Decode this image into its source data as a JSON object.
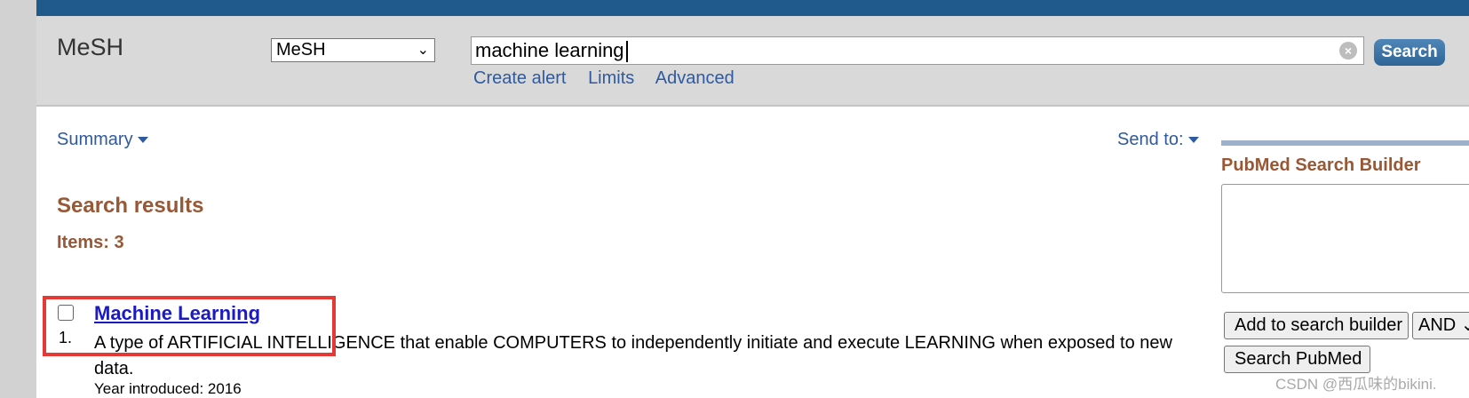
{
  "header": {
    "db_title": "MeSH",
    "db_select_value": "MeSH",
    "search_value": "machine learning",
    "search_button": "Search",
    "links": [
      "Create alert",
      "Limits",
      "Advanced"
    ]
  },
  "toolbar": {
    "summary": "Summary",
    "send_to": "Send to:"
  },
  "results": {
    "title": "Search results",
    "items_count": "Items: 3",
    "items": [
      {
        "number": "1.",
        "title": "Machine Learning",
        "description": "A type of ARTIFICIAL INTELLIGENCE that enable COMPUTERS to independently initiate and execute LEARNING when exposed to new data.",
        "year": "Year introduced: 2016"
      }
    ]
  },
  "sidebar": {
    "builder_title": "PubMed Search Builder",
    "add_button": "Add to search builder",
    "operator_value": "AND",
    "search_pubmed_button": "Search PubMed"
  },
  "watermark": "CSDN @西瓜味的bikini.",
  "colors": {
    "top_bar": "#205a8c",
    "header_bg": "#d9d9d9",
    "link": "#2f5aa0",
    "heading": "#985735",
    "highlight": "#e53935"
  }
}
